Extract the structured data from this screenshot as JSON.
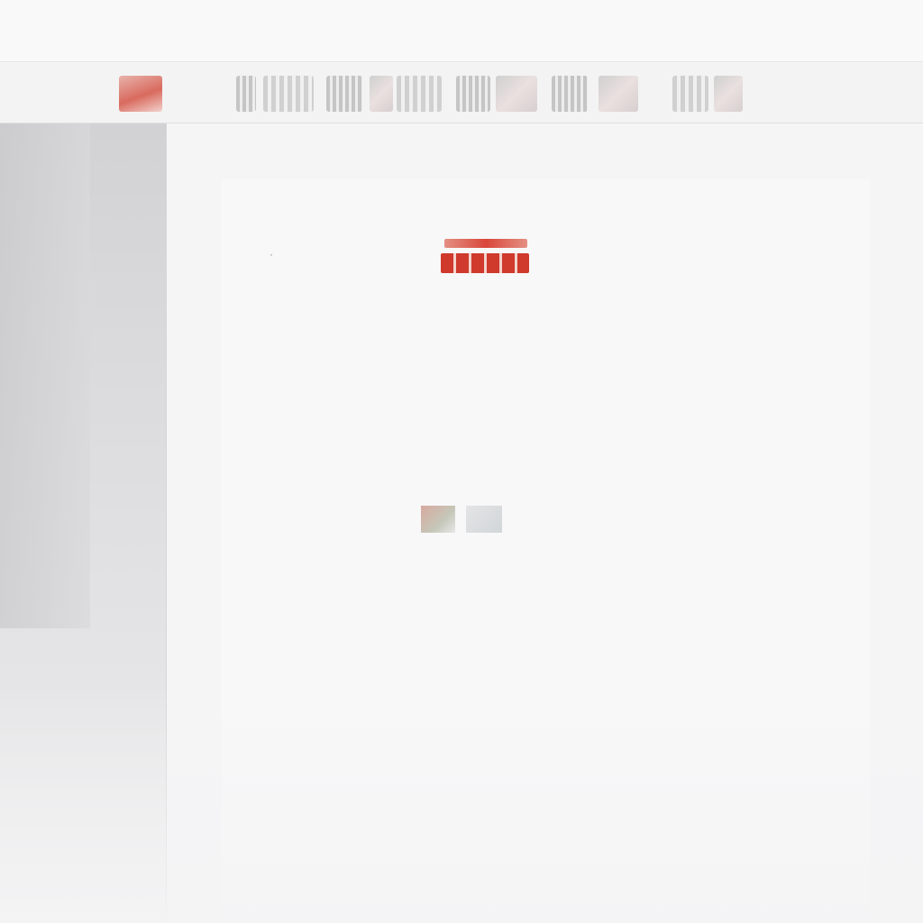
{
  "toolbar": {
    "buttons": [
      {
        "name": "home-icon"
      },
      {
        "name": "tool-icon-1"
      },
      {
        "name": "tool-icon-2"
      },
      {
        "name": "tool-icon-3"
      },
      {
        "name": "tool-icon-4"
      },
      {
        "name": "tool-icon-5"
      },
      {
        "name": "tool-icon-6"
      },
      {
        "name": "tool-icon-7"
      },
      {
        "name": "tool-icon-8"
      },
      {
        "name": "tool-icon-9"
      },
      {
        "name": "tool-icon-10"
      },
      {
        "name": "tool-icon-11"
      }
    ]
  },
  "document": {
    "breadcrumb": "",
    "header_text": "",
    "header_emphasis": "",
    "title": "",
    "paragraph_1": "",
    "paragraph_2": "",
    "meta_1": "",
    "meta_2": ""
  },
  "colors": {
    "accent": "#d9473a",
    "sidebar": "#d2d2d4",
    "background": "#f6f6f7"
  }
}
